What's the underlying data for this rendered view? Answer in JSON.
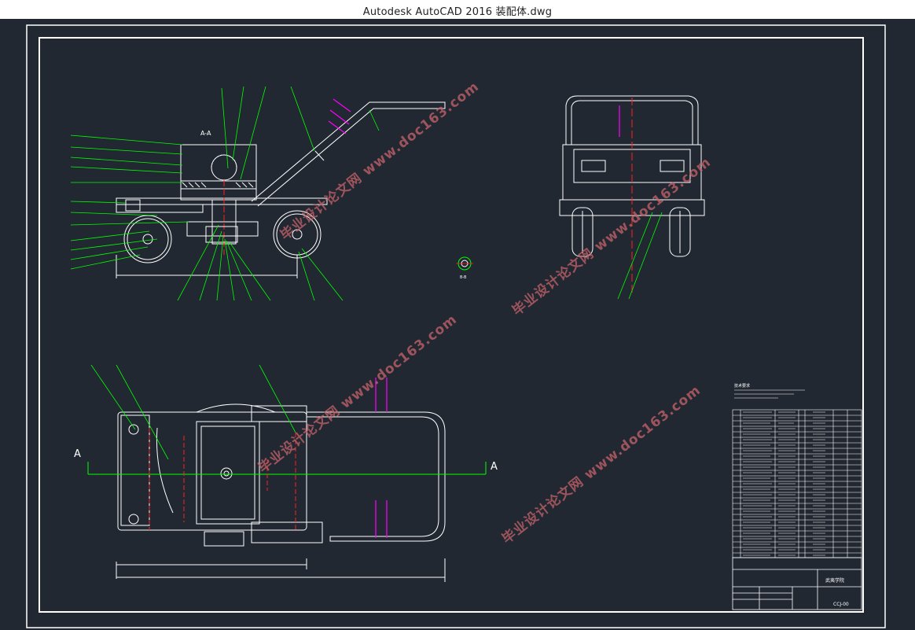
{
  "window": {
    "title": "Autodesk AutoCAD 2016    装配体.dwg"
  },
  "drawing": {
    "section_label": "A-A",
    "detail_label": "B-B",
    "cut_left": "A",
    "cut_right": "A",
    "watermark_text": "毕业设计论文网 www.doc163.com",
    "notes_title": "技术要求",
    "title_block": {
      "school": "武夷学院",
      "drawing_no": "CCJ-00"
    }
  },
  "colors": {
    "canvas": "#222831",
    "frame": "#ffffff",
    "geometry": "#ffffff",
    "leader": "#00ff00",
    "centerline_red": "#ff2020",
    "magenta": "#ff00ff",
    "watermark": "#c8636b"
  }
}
